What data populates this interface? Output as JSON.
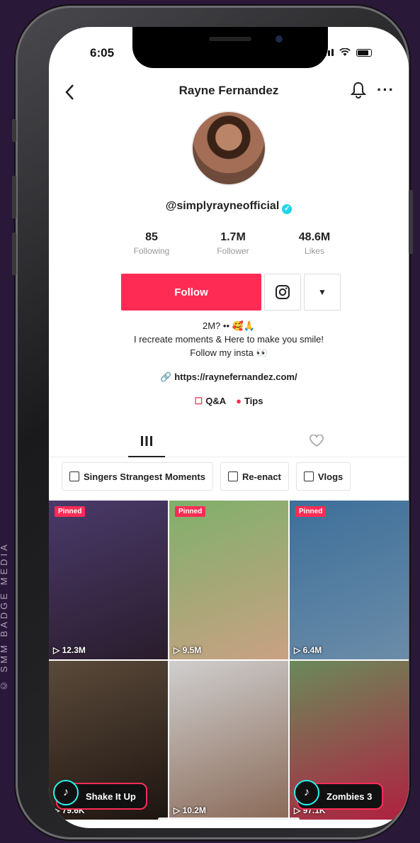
{
  "watermark": "© SMM BADGE MEDIA",
  "status": {
    "time": "6:05"
  },
  "nav": {
    "title": "Rayne Fernandez",
    "back_icon": "chevron-left-icon",
    "more": "···"
  },
  "profile": {
    "username": "@simplyrayneofficial",
    "stats": [
      {
        "value": "85",
        "label": "Following"
      },
      {
        "value": "1.7M",
        "label": "Follower"
      },
      {
        "value": "48.6M",
        "label": "Likes"
      }
    ],
    "follow_label": "Follow",
    "bio_line1": "2M? •• 🥰🙏",
    "bio_line2": "I recreate moments & Here to make you smile!",
    "bio_line3": "Follow my insta 👀",
    "link": "https://raynefernandez.com/",
    "qa_label": "Q&A",
    "tips_label": "Tips"
  },
  "playlists": [
    "Singers Strangest Moments",
    "Re-enact",
    "Vlogs"
  ],
  "videos": [
    {
      "pinned": "Pinned",
      "views": "▷ 12.3M",
      "colors": [
        "#4a3a6a",
        "#2a1c2c"
      ]
    },
    {
      "pinned": "Pinned",
      "views": "▷ 9.5M",
      "colors": [
        "#7fb06a",
        "#c9a184"
      ]
    },
    {
      "pinned": "Pinned",
      "views": "▷ 6.4M",
      "colors": [
        "#3d6f9a",
        "#6b8ca8"
      ]
    },
    {
      "pinned": "",
      "views": "▷ 79.6K",
      "colors": [
        "#5a4a3a",
        "#1e1410"
      ],
      "badge": "Shake It Up"
    },
    {
      "pinned": "",
      "views": "▷ 10.2M",
      "colors": [
        "#cfcfcf",
        "#8a6a58"
      ]
    },
    {
      "pinned": "",
      "views": "▷ 97.1K",
      "colors": [
        "#6a8a5a",
        "#b02040"
      ],
      "badge": "Zombies 3"
    }
  ],
  "accent": "#fe2c55"
}
